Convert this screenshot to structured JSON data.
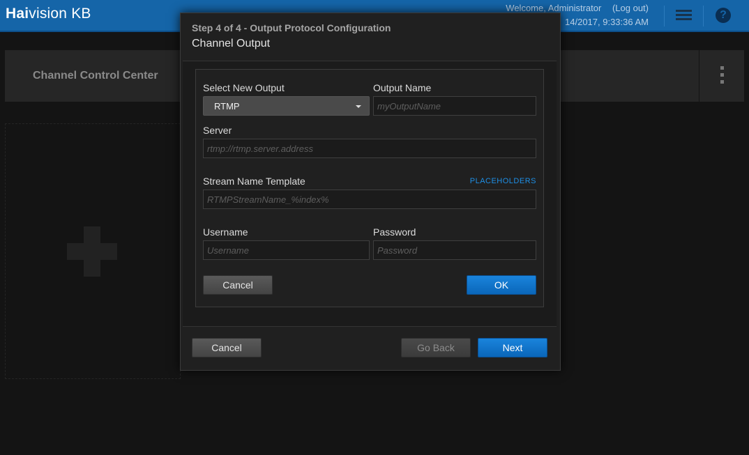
{
  "app": {
    "logo_bold": "Hai",
    "logo_rest": "vision KB",
    "welcome": "Welcome, Administrator",
    "logout": "(Log out)",
    "datetime": "14/2017, 9:33:36 AM"
  },
  "background": {
    "channel_control_center": "Channel Control Center"
  },
  "dialog": {
    "step": "Step 4 of 4 - Output Protocol Configuration",
    "title": "Channel Output",
    "form": {
      "select_label": "Select New Output",
      "select_value": "RTMP",
      "output_name_label": "Output Name",
      "output_name_placeholder": "myOutputName",
      "server_label": "Server",
      "server_placeholder": "rtmp://rtmp.server.address",
      "stream_template_label": "Stream Name Template",
      "placeholders_link": "PLACEHOLDERS",
      "stream_template_placeholder": "RTMPStreamName_%index%",
      "username_label": "Username",
      "username_placeholder": "Username",
      "password_label": "Password",
      "password_placeholder": "Password",
      "cancel": "Cancel",
      "ok": "OK"
    },
    "footer": {
      "cancel": "Cancel",
      "go_back": "Go Back",
      "next": "Next"
    }
  },
  "colors": {
    "topbar": "#1565a8",
    "accent": "#0a66b9",
    "link": "#1e8fe6"
  }
}
